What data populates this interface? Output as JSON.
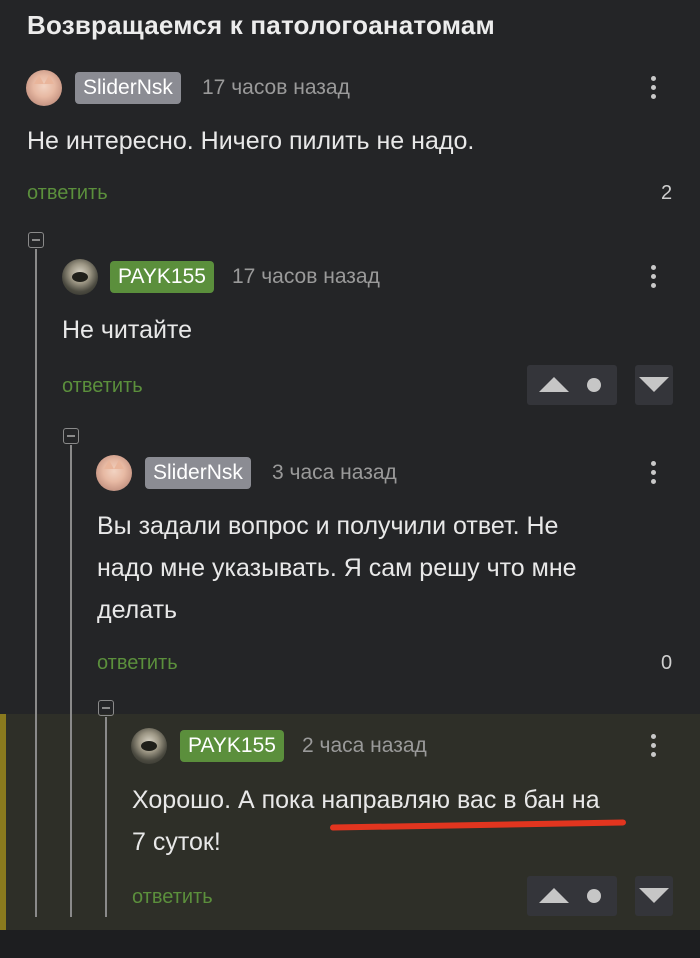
{
  "post": {
    "title": "Возвращаемся к патологоанатомам"
  },
  "comments": [
    {
      "user": "SliderNsk",
      "time": "17 часов назад",
      "text": "Не интересно. Ничего пилить не надо.",
      "reply": "ответить",
      "rating": "2"
    },
    {
      "user": "PAYK155",
      "time": "17 часов назад",
      "text": "Не читайте",
      "reply": "ответить"
    },
    {
      "user": "SliderNsk",
      "time": "3 часа назад",
      "text_lines": [
        "Вы задали вопрос и получили ответ. Не",
        "надо мне указывать. Я сам решу что мне",
        "делать"
      ],
      "reply": "ответить",
      "rating": "0"
    },
    {
      "user": "PAYK155",
      "time": "2 часа назад",
      "text_lines": [
        "Хорошо. А пока направляю вас в бан на",
        "7 суток!"
      ],
      "reply": "ответить"
    }
  ],
  "icons": {
    "more": "kebab-icon",
    "collapse": "collapse-minus-icon",
    "upvote": "arrow-up-icon",
    "downvote": "arrow-down-icon"
  },
  "colors": {
    "background": "#242527",
    "accent_green": "#5b8f3c",
    "badge_grey": "#8b8c93",
    "highlight_bar": "#8a7a1e",
    "underline_red": "#e2351f"
  }
}
